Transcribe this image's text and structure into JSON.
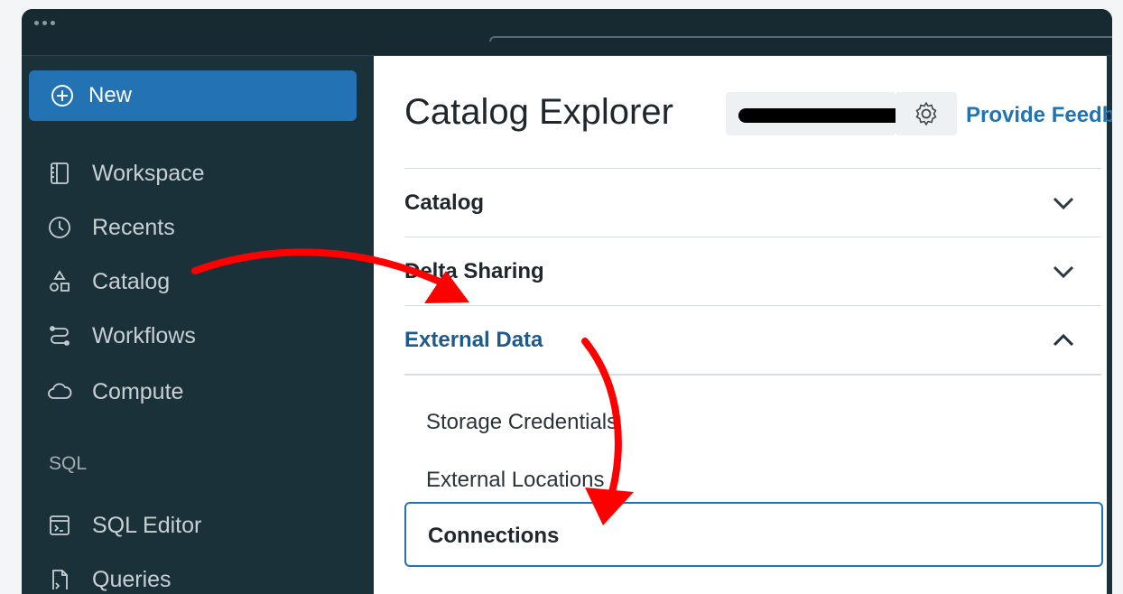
{
  "sidebar": {
    "new_label": "New",
    "items": [
      {
        "label": "Workspace",
        "icon": "workspace-icon"
      },
      {
        "label": "Recents",
        "icon": "clock-icon"
      },
      {
        "label": "Catalog",
        "icon": "catalog-icon"
      },
      {
        "label": "Workflows",
        "icon": "workflows-icon"
      },
      {
        "label": "Compute",
        "icon": "cloud-icon"
      }
    ],
    "section_label": "SQL",
    "sql_items": [
      {
        "label": "SQL Editor",
        "icon": "sql-editor-icon"
      },
      {
        "label": "Queries",
        "icon": "queries-icon"
      }
    ]
  },
  "main": {
    "title": "Catalog Explorer",
    "feedback_label": "Provide Feedback",
    "accordion": [
      {
        "label": "Catalog",
        "state": "collapsed"
      },
      {
        "label": "Delta Sharing",
        "state": "collapsed"
      },
      {
        "label": "External Data",
        "state": "expanded"
      }
    ],
    "external_data_items": [
      {
        "label": "Storage Credentials"
      },
      {
        "label": "External Locations"
      },
      {
        "label": "Connections",
        "selected": true
      }
    ]
  },
  "colors": {
    "sidebar_bg": "#1b3139",
    "accent": "#2272b4",
    "annotation_arrow": "#ff0000"
  }
}
